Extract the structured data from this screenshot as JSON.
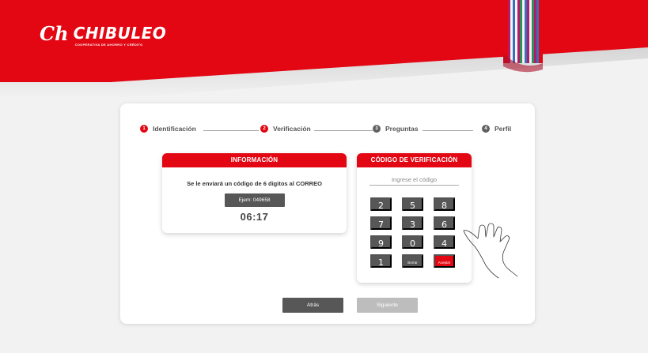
{
  "brand": {
    "logo_mark": "Ch",
    "name": "CHIBULEO",
    "subtitle": "COOPERATIVA DE AHORRO Y CRÉDITO"
  },
  "colors": {
    "primary_red": "#e30613",
    "dark_gray": "#575757",
    "disabled_gray": "#bdbdbd",
    "step_inactive": "#616161"
  },
  "steps": [
    {
      "number": "1",
      "label": "Identificación",
      "state": "active"
    },
    {
      "number": "2",
      "label": "Verificación",
      "state": "active"
    },
    {
      "number": "3",
      "label": "Preguntas",
      "state": "inactive"
    },
    {
      "number": "4",
      "label": "Perfil",
      "state": "inactive"
    }
  ],
  "info_panel": {
    "title": "INFORMACIÓN",
    "message": "Se le enviará un código de 6 digitos al CORREO",
    "example": "Ejem: 049658",
    "timer": "06:17"
  },
  "code_panel": {
    "title": "CÓDIGO DE VERIFICACIÓN",
    "input_placeholder": "Ingrese el código",
    "input_value": "",
    "keys": [
      "2",
      "5",
      "8",
      "7",
      "3",
      "6",
      "9",
      "0",
      "4",
      "1",
      "Borrar",
      "Aceptar"
    ]
  },
  "actions": {
    "back_label": "Atrás",
    "next_label": "Siguiente"
  },
  "icons": {
    "pointer": "hand-pointer-icon"
  }
}
